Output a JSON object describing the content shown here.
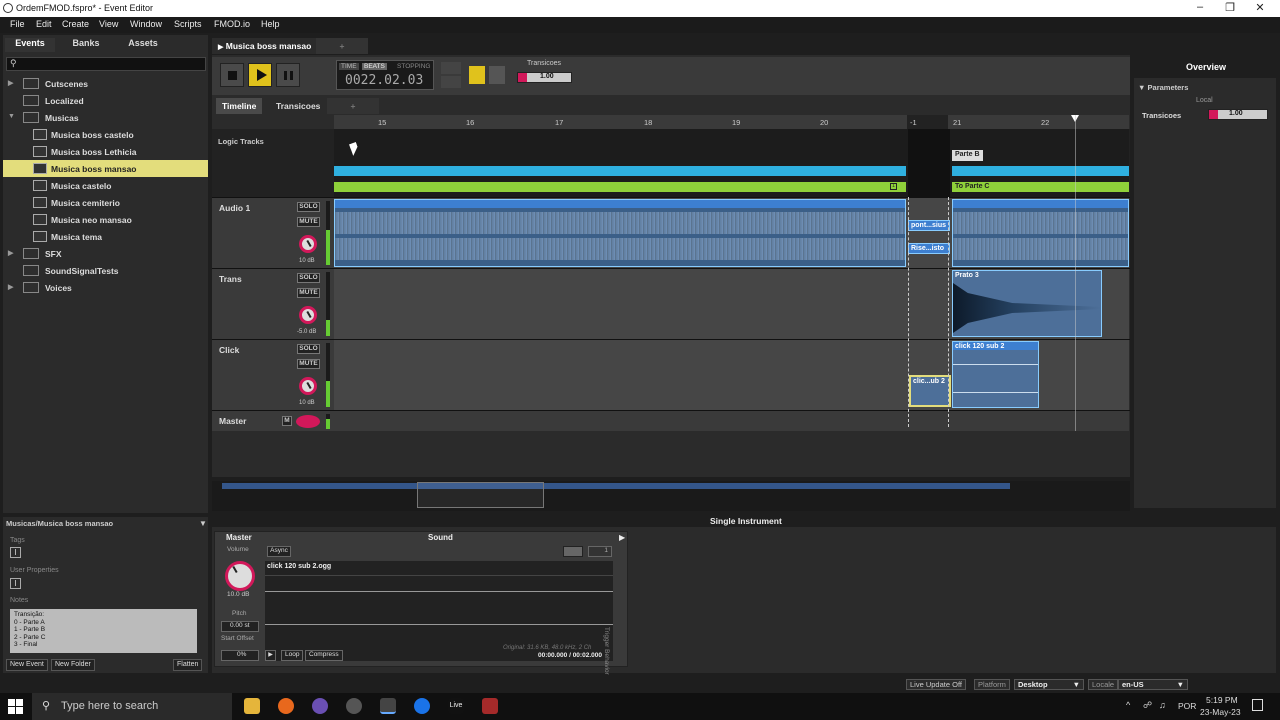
{
  "window": {
    "title": "OrdemFMOD.fspro* - Event Editor"
  },
  "menu": [
    "File",
    "Edit",
    "Create",
    "View",
    "Window",
    "Scripts",
    "FMOD.io",
    "Help"
  ],
  "browser": {
    "tabs": [
      "Events",
      "Banks",
      "Assets"
    ],
    "items": [
      {
        "label": "Cutscenes",
        "type": "folder",
        "level": 0
      },
      {
        "label": "Localized",
        "type": "folder",
        "level": 0
      },
      {
        "label": "Musicas",
        "type": "folder",
        "level": 0
      },
      {
        "label": "Musica boss castelo",
        "type": "event",
        "level": 1
      },
      {
        "label": "Musica boss Lethicia",
        "type": "event",
        "level": 1
      },
      {
        "label": "Musica boss mansao",
        "type": "event",
        "level": 1
      },
      {
        "label": "Musica castelo",
        "type": "event",
        "level": 1
      },
      {
        "label": "Musica cemiterio",
        "type": "event",
        "level": 1
      },
      {
        "label": "Musica neo mansao",
        "type": "event",
        "level": 1
      },
      {
        "label": "Musica tema",
        "type": "event",
        "level": 1
      },
      {
        "label": "SFX",
        "type": "folder",
        "level": 0
      },
      {
        "label": "SoundSignalTests",
        "type": "folder",
        "level": 0
      },
      {
        "label": "Voices",
        "type": "folder",
        "level": 0
      }
    ],
    "selected_path": "Musicas/Musica boss mansao",
    "tags_label": "Tags",
    "user_props_label": "User Properties",
    "notes_label": "Notes",
    "notes": [
      "Transição:",
      "0 - Parte A",
      "1 - Parte B",
      "2 - Parte C",
      "3 - Final"
    ],
    "new_event": "New Event",
    "new_folder": "New Folder",
    "flatten": "Flatten"
  },
  "editor": {
    "event_tab": "Musica boss mansao",
    "add_tab": "+",
    "transport": {
      "time_btn": "TIME",
      "beats_btn": "BEATS",
      "state": "STOPPING",
      "position": "0022.02.03"
    },
    "param_name": "Transicoes",
    "param_value": "1.00",
    "subtabs": [
      "Timeline",
      "Transicoes",
      "+"
    ],
    "ruler": [
      "15",
      "16",
      "17",
      "18",
      "19",
      "20",
      "-1",
      "21",
      "22"
    ],
    "logic_tracks_label": "Logic Tracks",
    "marker_parte_b": "Parte B",
    "transition_label": "To Parte C",
    "transition_badge": "1",
    "tracks": [
      {
        "name": "Audio 1",
        "db": "10 dB"
      },
      {
        "name": "Trans",
        "db": "-5.0 dB"
      },
      {
        "name": "Click",
        "db": "10 dB"
      },
      {
        "name": "Master",
        "db": ""
      }
    ],
    "solo": "SOLO",
    "mute": "MUTE",
    "master_m": "M",
    "clips": {
      "pont": "pont...sius",
      "rise": "Rise...isto",
      "prato": "Prato 3",
      "click_main": "click 120 sub 2",
      "click_small": "clic...ub 2"
    }
  },
  "overview": {
    "title": "Overview",
    "parameters": "Parameters",
    "local": "Local",
    "param_name": "Transicoes",
    "param_value": "1.00"
  },
  "deck": {
    "title": "Single Instrument",
    "master": "Master",
    "sound": "Sound",
    "volume_label": "Volume",
    "volume": "10.0 dB",
    "pitch_label": "Pitch",
    "pitch": "0.00 st",
    "start_offset_label": "Start Offset",
    "start_offset": "0%",
    "async": "Async",
    "filename": "click 120 sub 2.ogg",
    "file_info": "Original: 31.6 KB, 48.0 kHz, 2 Ch",
    "time": "00:00.000 / 00:02.000",
    "loop": "Loop",
    "compress": "Compress",
    "trigger": "Trigger Behavior",
    "count": "1"
  },
  "status": {
    "live_update": "Live Update Off",
    "platform_label": "Platform",
    "platform": "Desktop",
    "locale_label": "Locale",
    "locale": "en-US"
  },
  "taskbar": {
    "search": "Type here to search",
    "live_label": "Live",
    "lang": "POR",
    "time": "5:19 PM",
    "date": "23-May-23"
  }
}
